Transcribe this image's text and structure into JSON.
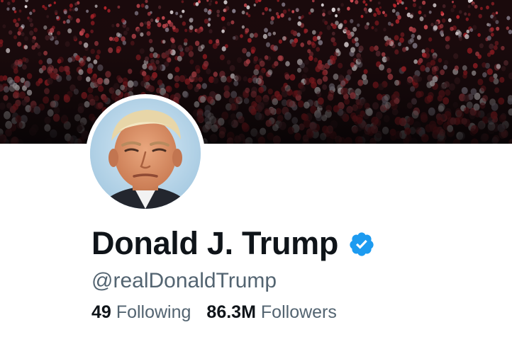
{
  "profile": {
    "display_name": "Donald J. Trump",
    "handle": "@realDonaldTrump",
    "verified": true,
    "stats": {
      "following_count": "49",
      "following_label": "Following",
      "followers_count": "86.3M",
      "followers_label": "Followers"
    }
  },
  "colors": {
    "name_text": "#0f1419",
    "secondary_text": "#536471",
    "verified_badge": "#1d9bf0",
    "banner_crowd_red": "#c0262d",
    "background": "#ffffff"
  },
  "icons": {
    "verified": "verified-badge-icon"
  }
}
